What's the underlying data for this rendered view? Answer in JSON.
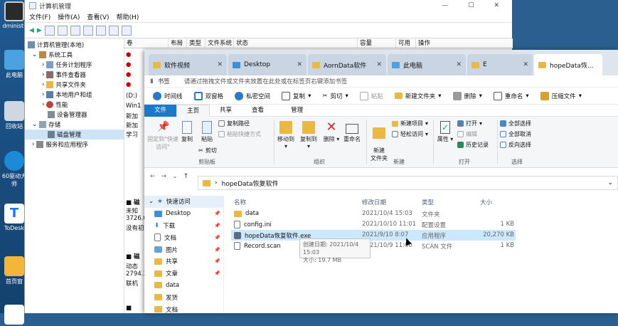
{
  "desktop": {
    "icons": [
      {
        "label": "dministr"
      },
      {
        "label": "此电脑"
      },
      {
        "label": "回收站"
      },
      {
        "label": "60驱动大师"
      },
      {
        "label": "ToDesk"
      },
      {
        "label": "首页窗"
      }
    ]
  },
  "computer_mgmt": {
    "title": "计算机管理",
    "menu": [
      "文件(F)",
      "操作(A)",
      "查看(V)",
      "帮助(H)"
    ],
    "tree": [
      {
        "label": "计算机管理(本地)"
      },
      {
        "label": "系统工具"
      },
      {
        "label": "任务计划程序"
      },
      {
        "label": "事件查看器"
      },
      {
        "label": "共享文件夹"
      },
      {
        "label": "本地用户和组"
      },
      {
        "label": "性能"
      },
      {
        "label": "设备管理器"
      },
      {
        "label": "存储"
      },
      {
        "label": "磁盘管理"
      },
      {
        "label": "服务和应用程序"
      }
    ],
    "columns": [
      "卷",
      "布局",
      "类型",
      "文件系统",
      "状态",
      "容量",
      "可用空",
      "操作"
    ],
    "volumes": [
      "(D:)",
      "Win1",
      "新加",
      "新加",
      "学习"
    ],
    "disk1": [
      "磁",
      "未知",
      "3726.0",
      "没有初"
    ],
    "disk2": [
      "磁",
      "动态",
      "2794.3",
      "联机"
    ]
  },
  "explorer": {
    "tabs": [
      {
        "label": "软件视频"
      },
      {
        "label": "Desktop"
      },
      {
        "label": "AornData软件"
      },
      {
        "label": "此电脑"
      },
      {
        "label": "E"
      },
      {
        "label": "hopeData恢..."
      }
    ],
    "bookmark_label": "书签",
    "bookmark_hint": "请通过拖拽文件或文件夹放置在此处或在标签页右键添加书签",
    "quick_toolbar": [
      "时间线",
      "双窗格",
      "私密空间",
      "复制",
      "剪切",
      "粘贴",
      "新建文件夹",
      "删除",
      "重命名",
      "压缩文件"
    ],
    "ribbon_tabs": [
      "文件",
      "主页",
      "共享",
      "查看",
      "管理"
    ],
    "ribbon": {
      "pin": "固定到\"快速访问\"",
      "copy": "复制",
      "paste": "粘贴",
      "copy_path": "复制路径",
      "paste_shortcut": "粘贴快捷方式",
      "cut": "剪切",
      "clipboard": "剪贴板",
      "move_to": "移动到",
      "copy_to": "复制到",
      "delete": "删除",
      "rename": "重命名",
      "organize": "组织",
      "new_folder": "新建\n文件夹",
      "new_item": "新建项目",
      "easy_access": "轻松访问",
      "new": "新建",
      "properties": "属性",
      "open": "打开",
      "edit": "编辑",
      "history": "历史记录",
      "open_group": "打开",
      "select_all": "全部选择",
      "select_none": "全部取消",
      "invert": "反向选择",
      "select": "选择"
    },
    "address": "hopeData恢复软件",
    "nav": [
      {
        "label": "快速访问"
      },
      {
        "label": "Desktop"
      },
      {
        "label": "下载"
      },
      {
        "label": "文档"
      },
      {
        "label": "图片"
      },
      {
        "label": "共享"
      },
      {
        "label": "文章"
      },
      {
        "label": "data"
      },
      {
        "label": "发货"
      },
      {
        "label": "文档"
      }
    ],
    "columns": {
      "name": "名称",
      "date": "修改日期",
      "type": "类型",
      "size": "大小"
    },
    "files": [
      {
        "name": "data",
        "date": "2021/10/4 15:03",
        "type": "文件夹",
        "size": ""
      },
      {
        "name": "config.ini",
        "date": "2021/10/10 11:01",
        "type": "配置设置",
        "size": "1 KB"
      },
      {
        "name": "hopeData恢复软件.exe",
        "date": "2021/9/10 8:07",
        "type": "应用程序",
        "size": "20,270 KB"
      },
      {
        "name": "Record.scan",
        "date": "2021/10/9 11:00",
        "type": "SCAN 文件",
        "size": "1 KB"
      }
    ],
    "tooltip": {
      "line1": "创建日期: 2021/10/4 15:03",
      "line2": "大小: 19.7 MB"
    }
  }
}
